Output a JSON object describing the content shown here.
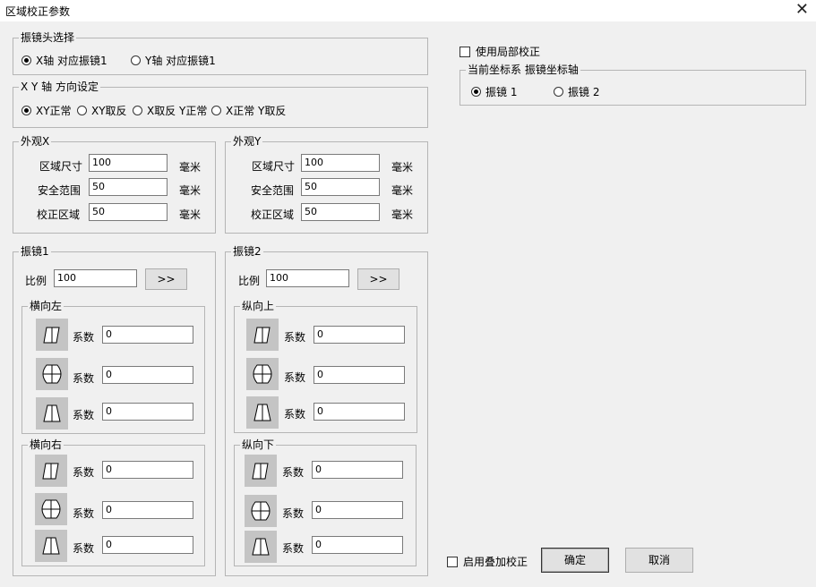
{
  "window": {
    "title": "区域校正参数",
    "close": "✕"
  },
  "galvo_head": {
    "legend": "振镜头选择",
    "opt1": "X轴 对应振镜1",
    "opt2": "Y轴 对应振镜1"
  },
  "xy_dir": {
    "legend": "X Y 轴 方向设定",
    "opts": [
      "XY正常",
      "XY取反",
      "X取反 Y正常",
      "X正常 Y取反"
    ]
  },
  "local": {
    "use_local": "使用局部校正",
    "coord_legend": "当前坐标系 振镜坐标轴",
    "g1": "振镜 1",
    "g2": "振镜 2"
  },
  "outer_x": {
    "legend": "外观X",
    "size_label": "区域尺寸",
    "size": "100",
    "safe_label": "安全范围",
    "safe": "50",
    "cal_label": "校正区域",
    "cal": "50",
    "unit": "毫米"
  },
  "outer_y": {
    "legend": "外观Y",
    "size_label": "区域尺寸",
    "size": "100",
    "safe_label": "安全范围",
    "safe": "50",
    "cal_label": "校正区域",
    "cal": "50",
    "unit": "毫米"
  },
  "galvo1": {
    "legend": "振镜1",
    "ratio_label": "比例",
    "ratio": "100",
    "arrow": ">>",
    "sub1": {
      "legend": "横向左",
      "coef_label": "系数",
      "v1": "0",
      "v2": "0",
      "v3": "0"
    },
    "sub2": {
      "legend": "横向右",
      "coef_label": "系数",
      "v1": "0",
      "v2": "0",
      "v3": "0"
    }
  },
  "galvo2": {
    "legend": "振镜2",
    "ratio_label": "比例",
    "ratio": "100",
    "arrow": ">>",
    "sub1": {
      "legend": "纵向上",
      "coef_label": "系数",
      "v1": "0",
      "v2": "0",
      "v3": "0"
    },
    "sub2": {
      "legend": "纵向下",
      "coef_label": "系数",
      "v1": "0",
      "v2": "0",
      "v3": "0"
    }
  },
  "footer": {
    "overlay": "启用叠加校正",
    "ok": "确定",
    "cancel": "取消"
  },
  "icons": [
    "parallelogram-icon",
    "barrel-icon",
    "trapezoid-icon"
  ]
}
